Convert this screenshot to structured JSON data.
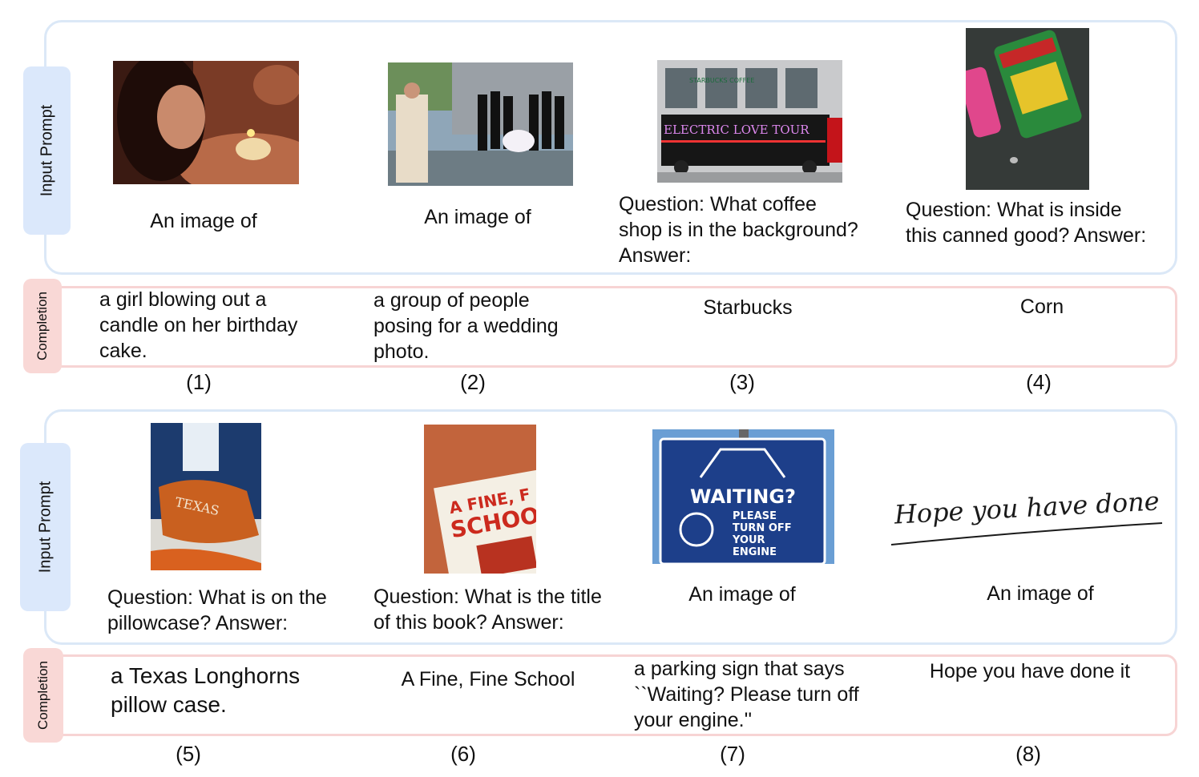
{
  "sections": {
    "prompt_label": "Input Prompt",
    "completion_label": "Completion"
  },
  "examples": [
    {
      "id": "(1)",
      "prompt": "An image of",
      "completion": "a girl blowing out a\ncandle on her birthday\ncake."
    },
    {
      "id": "(2)",
      "prompt": "An image of",
      "completion": "a group of people\nposing for a wedding\nphoto."
    },
    {
      "id": "(3)",
      "prompt": "Question: What coffee\nshop is in the background?\nAnswer:",
      "completion": "Starbucks"
    },
    {
      "id": "(4)",
      "prompt": "Question: What is inside\nthis canned good? Answer:",
      "completion": "Corn"
    },
    {
      "id": "(5)",
      "prompt": "Question: What is on the\npillowcase? Answer:",
      "completion": "a Texas Longhorns\npillow case."
    },
    {
      "id": "(6)",
      "prompt": "Question: What is the title\nof this book? Answer:",
      "completion": "A Fine, Fine School"
    },
    {
      "id": "(7)",
      "prompt": "An image of",
      "completion": "a parking sign that says\n``Waiting? Please turn off\nyour engine.''"
    },
    {
      "id": "(8)",
      "prompt": "An image of",
      "completion": "Hope you have done it"
    }
  ],
  "image_text": {
    "bus_sign": "ELECTRIC LOVE TOUR",
    "store_sign": "STARBUCKS COFFEE",
    "pillow_text": "TEXAS",
    "book_title_1": "A FINE, F",
    "book_title_2": "SCHOO",
    "sign_title": "WAITING?",
    "sign_sub": "PLEASE\nTURN OFF\nYOUR\nENGINE",
    "handwriting": "Hope you have done it."
  },
  "colors": {
    "prompt_border": "#dbe8f7",
    "prompt_tag": "#dbe8fb",
    "completion_border": "#f7d4d4",
    "completion_tag": "#f9d8d6"
  }
}
